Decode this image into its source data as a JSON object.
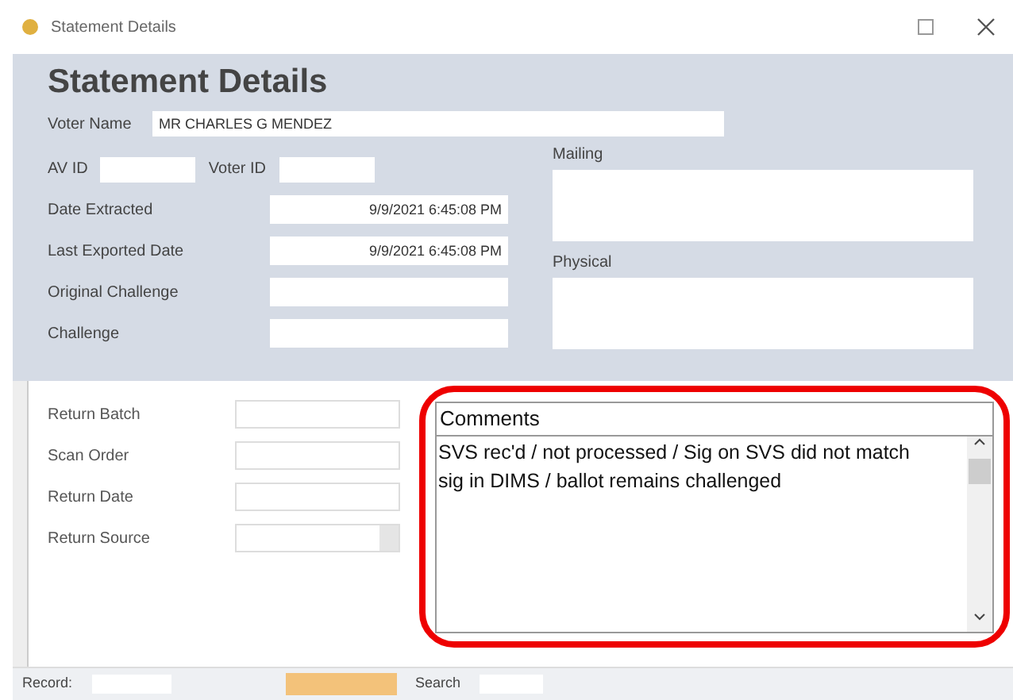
{
  "window": {
    "title": "Statement Details"
  },
  "header": {
    "heading": "Statement Details"
  },
  "voter": {
    "label": "Voter Name",
    "value": "MR CHARLES G MENDEZ"
  },
  "id_fields": [
    {
      "label": "AV ID"
    },
    {
      "label": "Voter ID"
    }
  ],
  "fields": [
    {
      "label": "Date Extracted",
      "value": "9/9/2021 6:45:08 PM"
    },
    {
      "label": "Last Exported Date",
      "value": "9/9/2021 6:45:08 PM"
    },
    {
      "label": "Original Challenge"
    },
    {
      "label": "Challenge"
    }
  ],
  "addresses": [
    {
      "label": "Mailing"
    },
    {
      "label": "Physical"
    }
  ],
  "return_fields": [
    {
      "label": "Return Batch",
      "kind": "text"
    },
    {
      "label": "Scan Order",
      "kind": "text"
    },
    {
      "label": "Return Date",
      "kind": "text"
    },
    {
      "label": "Return Source",
      "kind": "dropdown"
    }
  ],
  "comments": {
    "label": "Comments",
    "value": "SVS rec'd / not processed / Sig on SVS did not match sig in DIMS / ballot remains challenged",
    "highlighted": true
  },
  "nav": {
    "record_label": "Record:",
    "search_label": "Search"
  }
}
